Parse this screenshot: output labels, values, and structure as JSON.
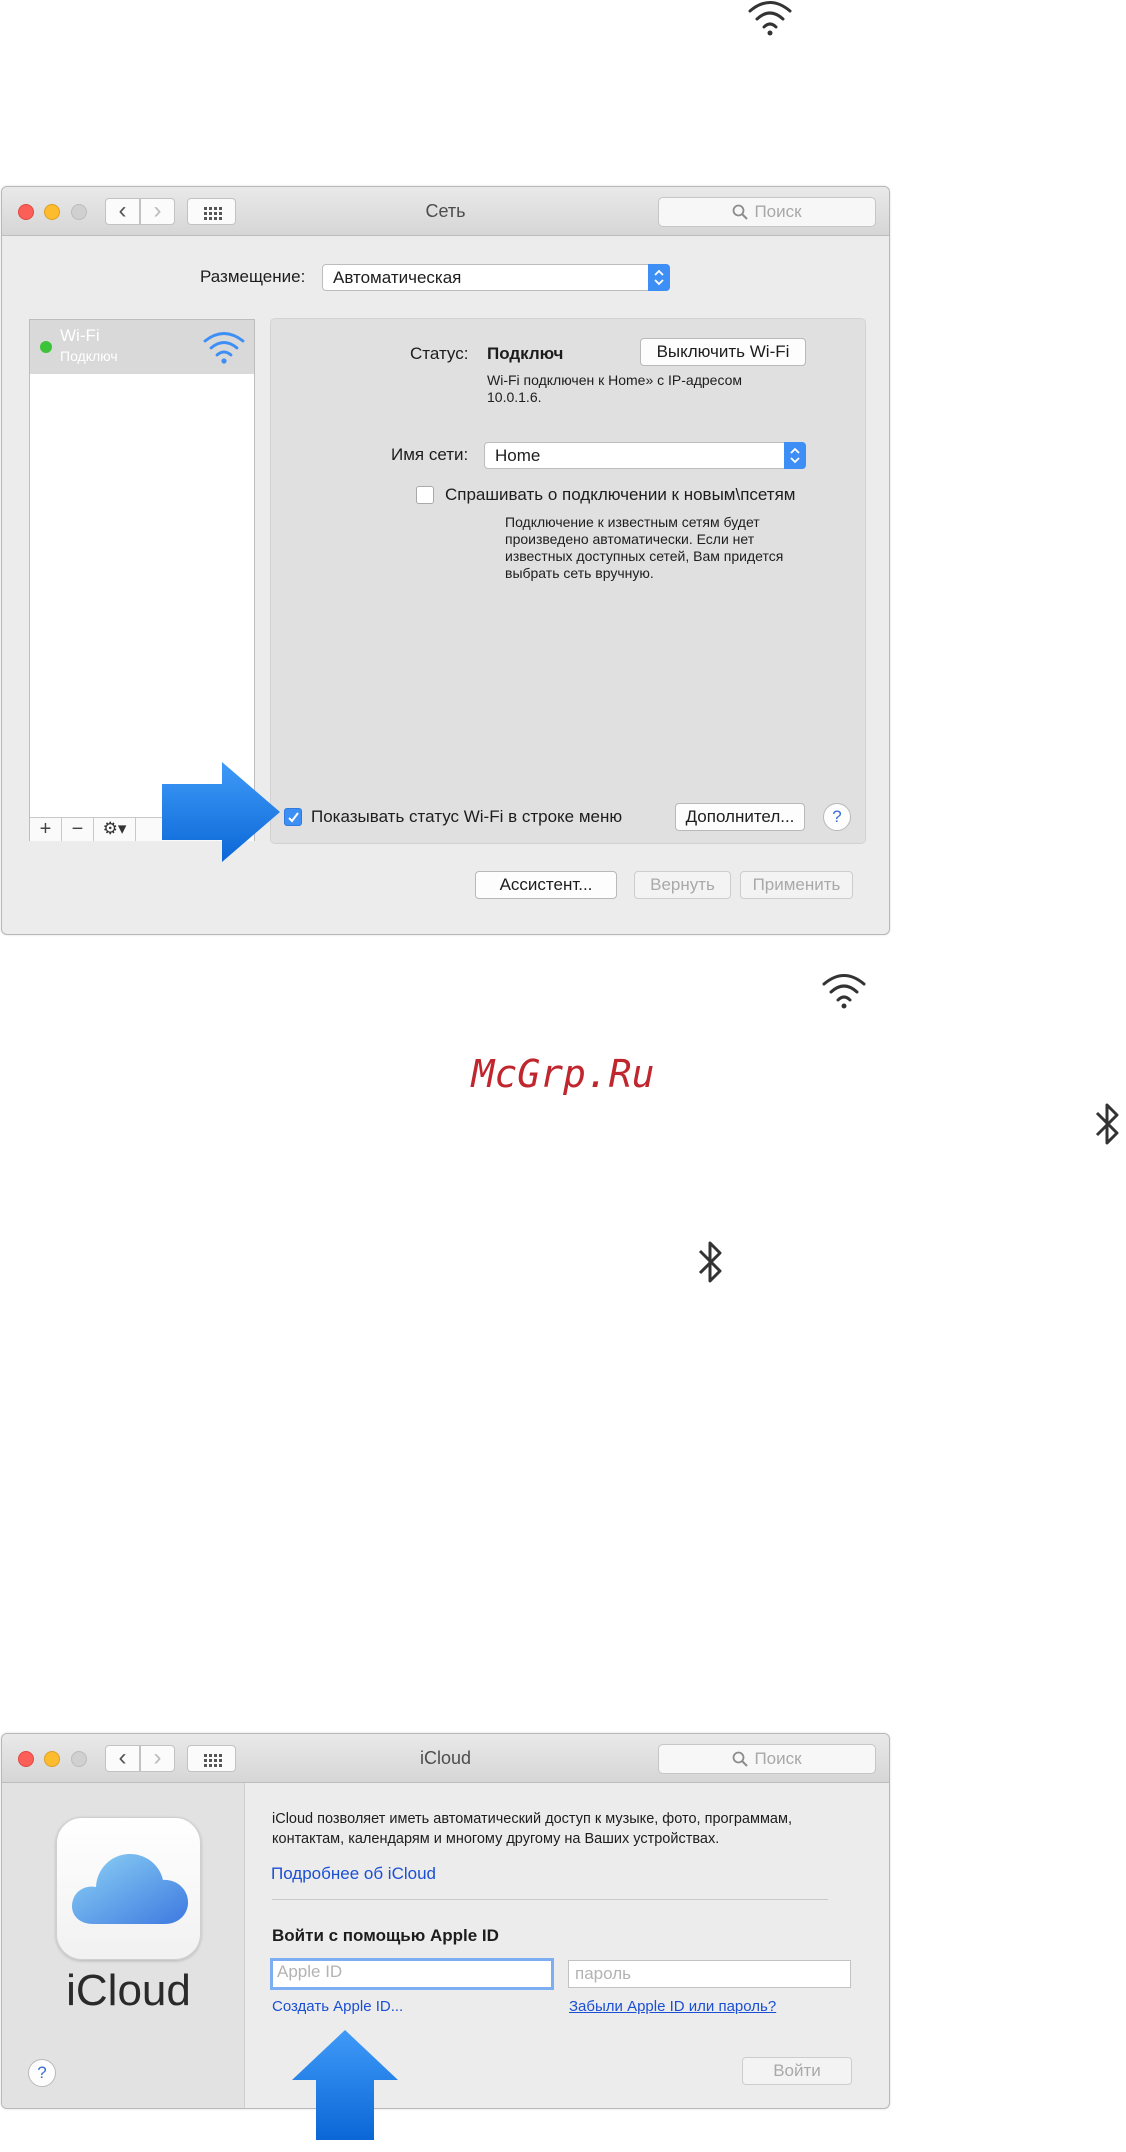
{
  "watermark": "McGrp.Ru",
  "icons": {
    "wifi_top": "wifi-icon",
    "wifi_middle": "wifi-icon",
    "bluetooth_right": "bluetooth-icon",
    "bluetooth_center": "bluetooth-icon"
  },
  "colors": {
    "accent_blue": "#3d8ef5",
    "arrow_blue": "#1477e6",
    "watermark_red": "#c0262e",
    "link_blue": "#1b4fd3",
    "status_green": "#3cc33a"
  },
  "network_window": {
    "title": "Сеть",
    "search_placeholder": "Поиск",
    "location_label": "Размещение:",
    "location_value": "Автоматическая",
    "services": [
      {
        "name": "Wi-Fi",
        "status": "Подключ"
      }
    ],
    "status_label": "Статус:",
    "status_value": "Подключ",
    "turn_off_button": "Выключить Wi-Fi",
    "status_description_line1": "Wi-Fi подключен к Home» с IP-адресом",
    "status_description_line2": "10.0.1.6.",
    "network_name_label": "Имя сети:",
    "network_name_value": "Home",
    "ask_checkbox_label": "Спрашивать о подключении к новым\\псетям",
    "ask_checkbox_checked": false,
    "ask_description": [
      "Подключение к известным сетям будет",
      "произведено автоматически. Если нет",
      "известных доступных сетей, Вам придется",
      "выбрать сеть вручную."
    ],
    "show_status_label": "Показывать статус Wi-Fi в строке меню",
    "show_status_checked": true,
    "advanced_button": "Дополнител...",
    "help_button": "?",
    "add_button": "+",
    "remove_button": "−",
    "gear_button": "gear-icon",
    "assistant_button": "Ассистент...",
    "revert_button": "Вернуть",
    "apply_button": "Применить"
  },
  "icloud_window": {
    "title": "iCloud",
    "search_placeholder": "Поиск",
    "app_name": "iCloud",
    "description_line1": "iCloud позволяет иметь автоматический доступ к музыке, фото, программам,",
    "description_line2": "контактам, календарям и многому другому на Ваших устройствах.",
    "learn_more_link": "Подробнее об iCloud",
    "sign_in_heading": "Войти с помощью Apple ID",
    "apple_id_placeholder": "Apple ID",
    "password_placeholder": "пароль",
    "create_apple_id_link": "Создать Apple ID...",
    "forgot_link": "Забыли Apple ID или пароль?",
    "sign_in_button": "Войти",
    "help_button": "?"
  }
}
